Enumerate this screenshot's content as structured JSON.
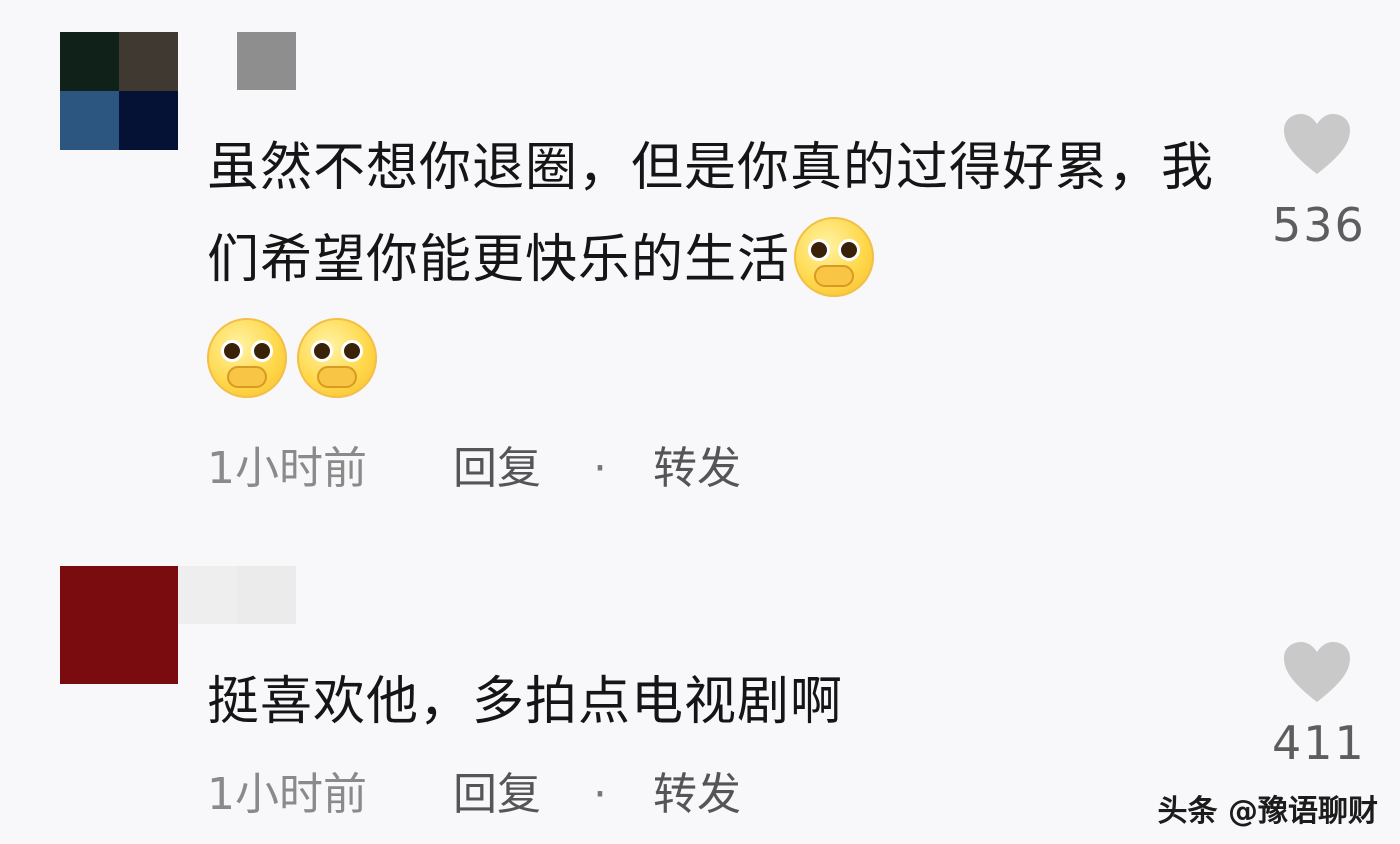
{
  "comments": [
    {
      "text": "虽然不想你退圈，但是你真的过得好累，我们希望你能更快乐的生活",
      "time": "1小时前",
      "reply": "回复",
      "separator": "·",
      "forward": "转发",
      "likes": "536",
      "emoji": "pleading-hand-over-mouth",
      "avatar_colors": [
        "#0f2119",
        "#3f3932",
        "#2c5680",
        "#061235"
      ]
    },
    {
      "text": "挺喜欢他，多拍点电视剧啊",
      "time": "1小时前",
      "reply": "回复",
      "separator": "·",
      "forward": "转发",
      "likes": "411",
      "avatar_colors": [
        "#7a0c10"
      ]
    }
  ],
  "watermark": "头条 @豫语聊财",
  "colors": {
    "heart": "#c9c9c9",
    "text": "#151515",
    "meta": "#6d6d6d"
  }
}
